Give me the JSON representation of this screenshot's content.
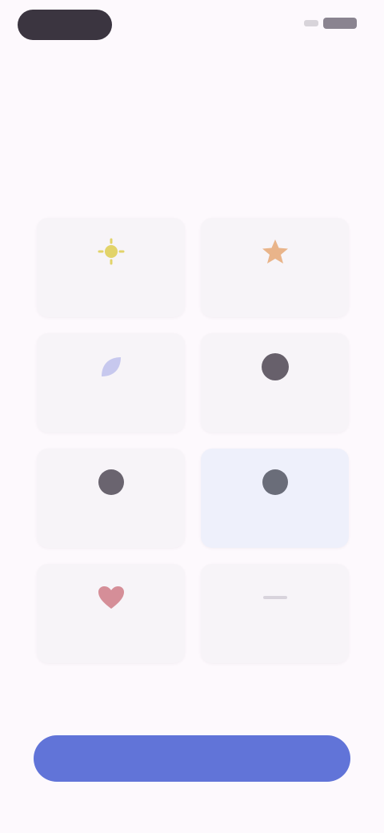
{
  "header": {
    "title": "",
    "subtitle": ""
  },
  "options": [
    {
      "label": "",
      "icon": "sun-icon",
      "color": "#e2d36a"
    },
    {
      "label": "",
      "icon": "star-icon",
      "color": "#e9b48a"
    },
    {
      "label": "",
      "icon": "leaf-icon",
      "color": "#c7c8ee"
    },
    {
      "label": "",
      "icon": "circle-icon",
      "color": "#67606b"
    },
    {
      "label": "",
      "icon": "circle-icon",
      "color": "#6a646f"
    },
    {
      "label": "",
      "icon": "circle-icon",
      "color": "#6a6d79"
    },
    {
      "label": "",
      "icon": "heart-icon",
      "color": "#d58e98"
    },
    {
      "label": "",
      "icon": "dash-icon",
      "color": "#d8d3dc"
    }
  ],
  "cta": {
    "label": ""
  },
  "colors": {
    "accent": "#6174d8",
    "background": "#fdf9fd"
  }
}
